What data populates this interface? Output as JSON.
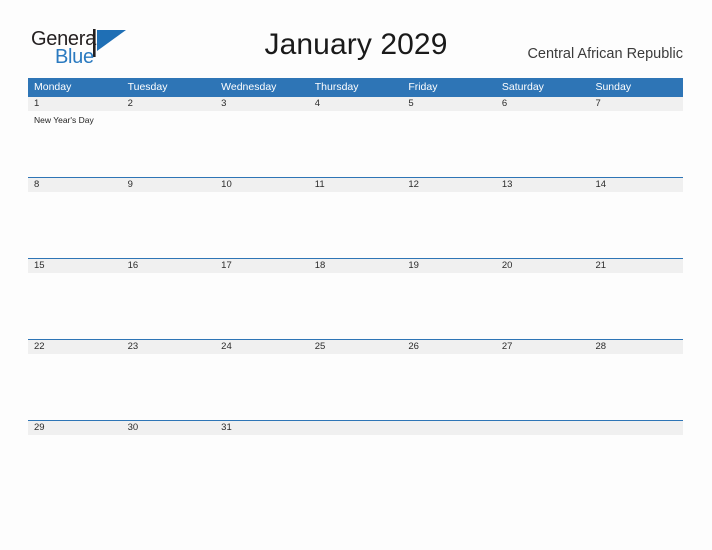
{
  "brand": {
    "name_top": "General",
    "name_bottom": "Blue",
    "flag_icon": "blue-flag-triangle-icon",
    "accent_color": "#2a7ac0"
  },
  "header": {
    "title": "January 2029",
    "country": "Central African Republic"
  },
  "theme": {
    "header_blue": "#2e75b6",
    "band_gray": "#f0f0f0",
    "page_background": "#fdfdfd",
    "text_dark": "#1a1a1a"
  },
  "calendar": {
    "month": "January",
    "year": "2029",
    "week_start": "Monday",
    "weekdays": [
      "Monday",
      "Tuesday",
      "Wednesday",
      "Thursday",
      "Friday",
      "Saturday",
      "Sunday"
    ],
    "weeks": [
      {
        "dates": [
          "1",
          "2",
          "3",
          "4",
          "5",
          "6",
          "7"
        ],
        "events": [
          "New Year's Day",
          "",
          "",
          "",
          "",
          "",
          ""
        ]
      },
      {
        "dates": [
          "8",
          "9",
          "10",
          "11",
          "12",
          "13",
          "14"
        ],
        "events": [
          "",
          "",
          "",
          "",
          "",
          "",
          ""
        ]
      },
      {
        "dates": [
          "15",
          "16",
          "17",
          "18",
          "19",
          "20",
          "21"
        ],
        "events": [
          "",
          "",
          "",
          "",
          "",
          "",
          ""
        ]
      },
      {
        "dates": [
          "22",
          "23",
          "24",
          "25",
          "26",
          "27",
          "28"
        ],
        "events": [
          "",
          "",
          "",
          "",
          "",
          "",
          ""
        ]
      },
      {
        "dates": [
          "29",
          "30",
          "31",
          "",
          "",
          "",
          ""
        ],
        "events": [
          "",
          "",
          "",
          "",
          "",
          "",
          ""
        ]
      }
    ]
  }
}
